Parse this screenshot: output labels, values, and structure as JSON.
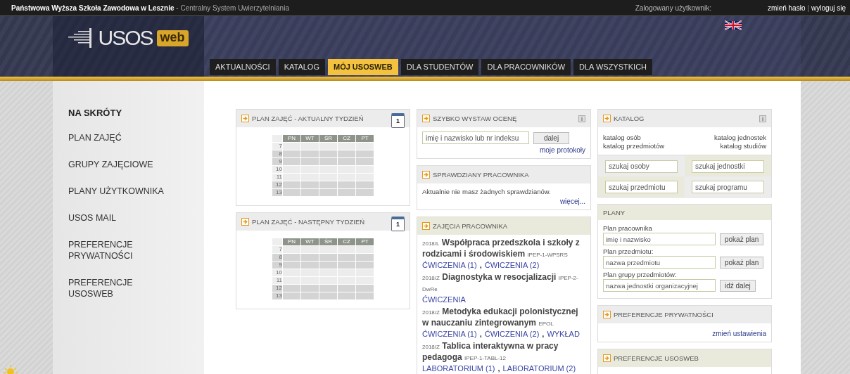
{
  "top_bar": {
    "institution": "Państwowa Wyższa Szkoła Zawodowa w Lesznie",
    "subtitle": "- Centralny System Uwierzytelniania",
    "user_label": "Zalogowany użytkownik:",
    "links": [
      "zmień hasło",
      "wyloguj się"
    ],
    "link_separator": "|"
  },
  "logo": {
    "usos": "USOS",
    "web": "web"
  },
  "tabs": [
    {
      "label": "AKTUALNOŚCI",
      "selected": false
    },
    {
      "label": "KATALOG",
      "selected": false
    },
    {
      "label": "MÓJ USOSWEB",
      "selected": true
    },
    {
      "label": "DLA STUDENTÓW",
      "selected": false
    },
    {
      "label": "DLA PRACOWNIKÓW",
      "selected": false
    },
    {
      "label": "DLA WSZYSTKICH",
      "selected": false
    }
  ],
  "sidebar": {
    "heading": "NA SKRÓTY",
    "items": [
      "PLAN ZAJĘĆ",
      "GRUPY ZAJĘCIOWE",
      "PLANY UŻYTKOWNIKA",
      "USOS MAIL",
      "PREFERENCJE PRYWATNOŚCI",
      "PREFERENCJE USOSWEB"
    ]
  },
  "timetables": [
    {
      "title": "PLAN ZAJĘĆ - AKTUALNY TYDZIEŃ",
      "calendar_day": "1",
      "days": [
        "PN",
        "WT",
        "ŚR",
        "CZ",
        "PT"
      ],
      "hours": [
        "7",
        "8",
        "9",
        "10",
        "11",
        "12",
        "13"
      ]
    },
    {
      "title": "PLAN ZAJĘĆ - NASTĘPNY TYDZIEŃ",
      "calendar_day": "1",
      "days": [
        "PN",
        "WT",
        "ŚR",
        "CZ",
        "PT"
      ],
      "hours": [
        "7",
        "8",
        "9",
        "10",
        "11",
        "12",
        "13"
      ]
    }
  ],
  "quick_grade": {
    "title": "SZYBKO WYSTAW OCENĘ",
    "placeholder": "imię i nazwisko lub nr indeksu",
    "button": "dalej",
    "link": "moje protokoły"
  },
  "tests": {
    "title": "SPRAWDZIANY PRACOWNIKA",
    "message": "Aktualnie nie masz żadnych sprawdzianów.",
    "link": "więcej..."
  },
  "classes": {
    "title": "ZAJĘCIA PRACOWNIKA",
    "group_separator": ",",
    "courses": [
      {
        "term": "2018/L",
        "name": "Współpraca przedszkola i szkoły z rodzicami i środowiskiem",
        "code": "IPEP-1-WPSRS",
        "groups": [
          "ĆWICZENIA (1)",
          "ĆWICZENIA (2)"
        ]
      },
      {
        "term": "2018/Z",
        "name": "Diagnostyka w resocjalizacji",
        "code": "IPEP-2-DwRe",
        "groups": [
          "ĆWICZENIA"
        ]
      },
      {
        "term": "2018/Z",
        "name": "Metodyka edukacji polonistycznej w nauczaniu zintegrowanym",
        "code": "EPOL",
        "groups": [
          "ĆWICZENIA (1)",
          "ĆWICZENIA (2)",
          "WYKŁAD"
        ]
      },
      {
        "term": "2018/Z",
        "name": "Tablica interaktywna w pracy pedagoga",
        "code": "IPEP-1-TABL-12",
        "groups": [
          "LABORATORIUM (1)",
          "LABORATORIUM (2)"
        ]
      }
    ]
  },
  "catalog": {
    "title": "KATALOG",
    "links": [
      "katalog osób",
      "katalog jednostek",
      "katalog przedmiotów",
      "katalog studiów"
    ],
    "searches": [
      {
        "placeholder": "szukaj osoby"
      },
      {
        "placeholder": "szukaj jednostki"
      },
      {
        "placeholder": "szukaj przedmiotu"
      },
      {
        "placeholder": "szukaj programu"
      }
    ]
  },
  "plans": {
    "title": "PLANY",
    "rows": [
      {
        "label": "Plan pracownika",
        "placeholder": "imię i nazwisko",
        "button": "pokaż plan"
      },
      {
        "label": "Plan przedmiotu:",
        "placeholder": "nazwa przedmiotu",
        "button": "pokaż plan"
      },
      {
        "label": "Plan grupy przedmiotów:",
        "placeholder": "nazwa jednostki organizacyjnej",
        "button": "idź dalej"
      }
    ]
  },
  "privacy": {
    "title": "PREFERENCJE PRYWATNOŚCI",
    "link": "zmień ustawienia"
  },
  "usosweb_prefs": {
    "title": "PREFERENCJE USOSWEB"
  }
}
